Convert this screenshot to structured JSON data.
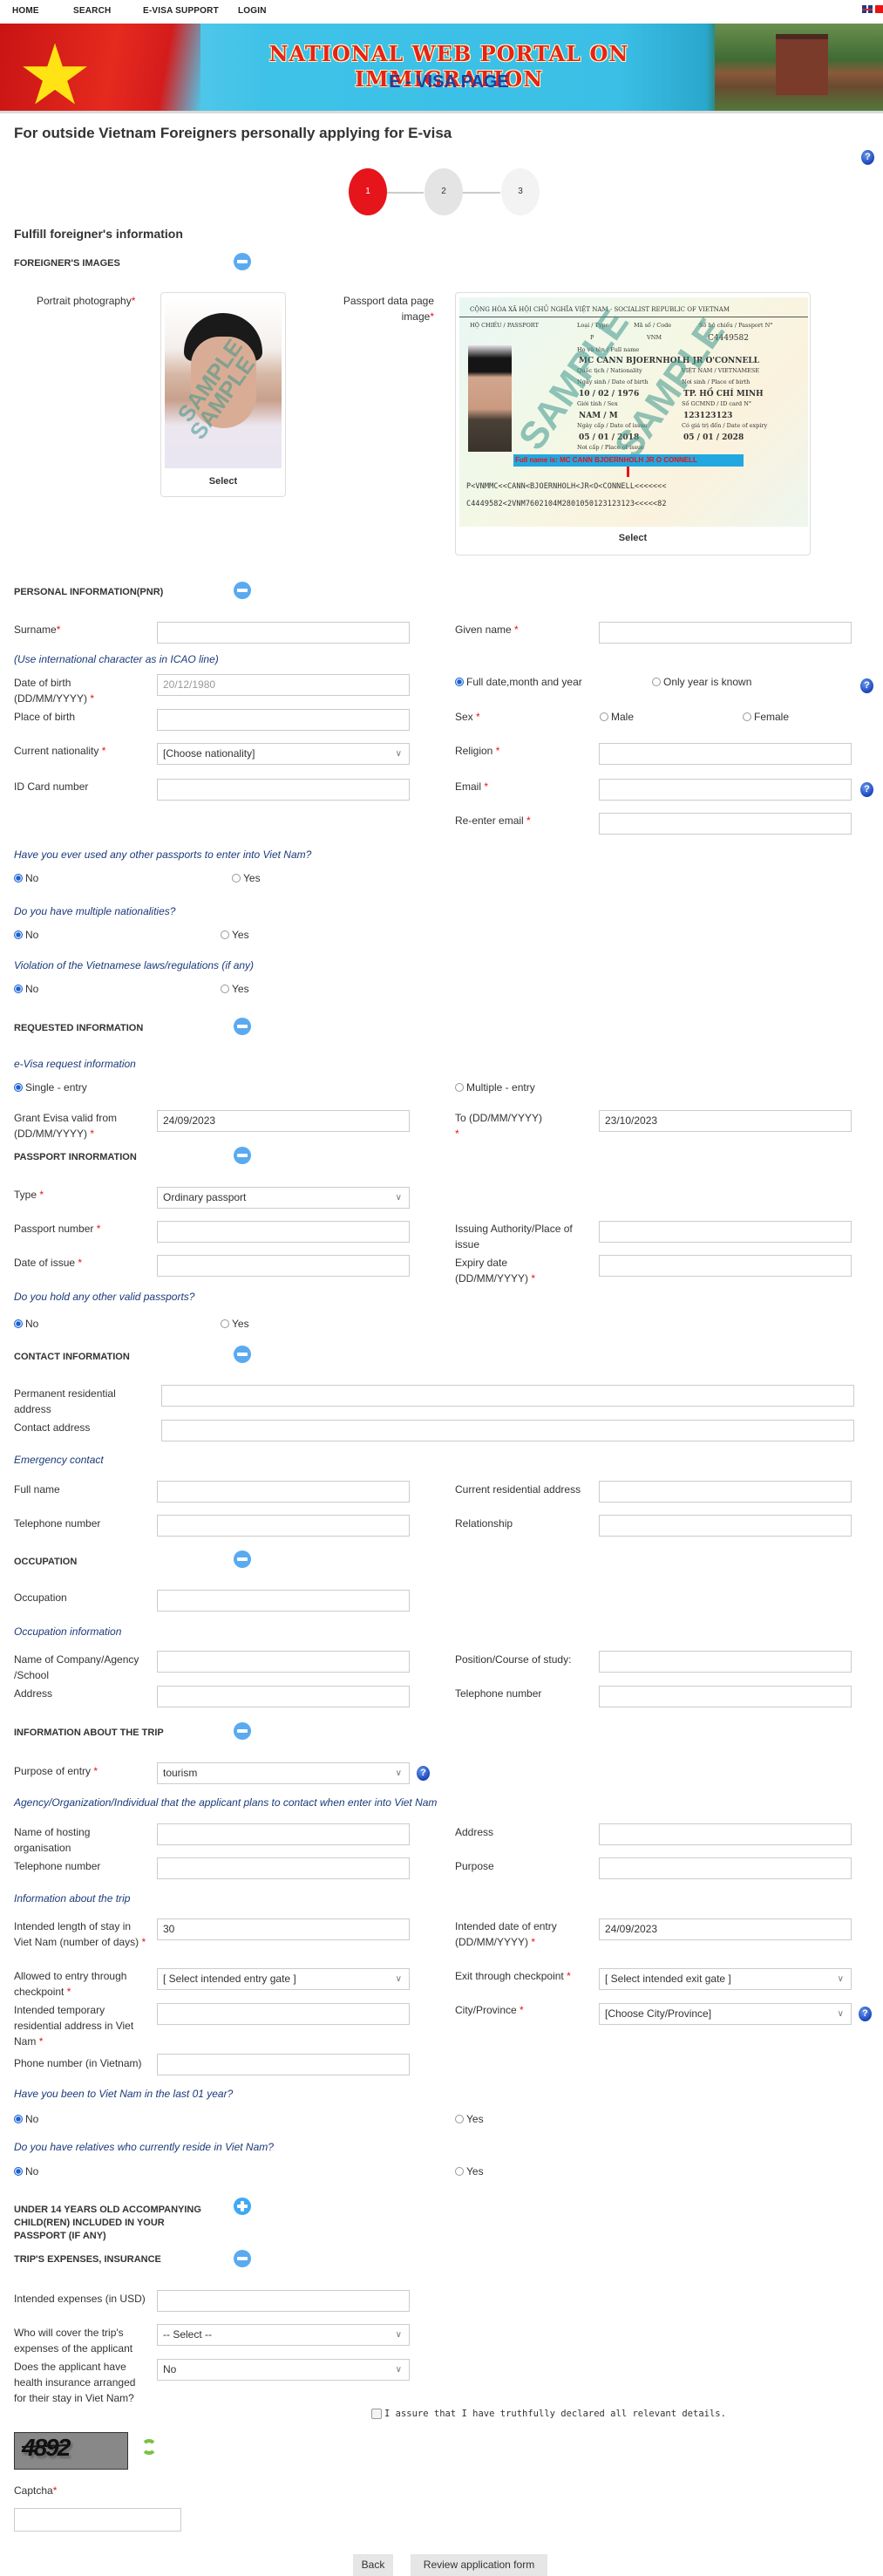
{
  "nav": {
    "items": [
      "HOME",
      "SEARCH",
      "E-VISA SUPPORT",
      "LOGIN"
    ],
    "languages": [
      "English",
      "Tiếng Việt"
    ]
  },
  "banner": {
    "title": "NATIONAL WEB PORTAL ON IMMIGRATION",
    "subtitle": "E - VISA PAGE"
  },
  "page_title": "For outside Vietnam Foreigners personally applying for E-visa",
  "stepper": {
    "steps": [
      "1",
      "2",
      "3"
    ],
    "current_step": 1,
    "colors": {
      "active": "#e6151b",
      "next": "#e4e4e4",
      "future": "#f3f3f3"
    }
  },
  "form_heading": "Fulfill foreigner's information",
  "images": {
    "section": "FOREIGNER'S IMAGES",
    "portrait_label": "Portrait photography",
    "passport_label": "Passport data page image",
    "select_label": "Select",
    "watermark": "SAMPLE",
    "passport_sample": {
      "header": "CỘNG HÒA XÃ HỘI CHỦ NGHĨA VIỆT NAM - SOCIALIST REPUBLIC OF VIETNAM",
      "passport_label": "HỘ CHIẾU / PASSPORT",
      "type_label": "Loại / Type",
      "type": "P",
      "code_label": "Mã số / Code",
      "code": "VNM",
      "number_label": "Số hộ chiếu / Passport N°",
      "number": "C4449582",
      "fullname_label": "Họ và tên / Full name",
      "fullname": "MC CANN BJOERNHOLH JR O'CONNELL",
      "nationality_label": "Quốc tịch / Nationality",
      "nationality": "VIỆT NAM / VIETNAMESE",
      "dob_label": "Ngày sinh / Date of birth",
      "dob": "10 / 02 / 1976",
      "pob_label": "Nơi sinh / Place of birth",
      "pob": "TP. HỒ CHÍ MINH",
      "sex_label": "Giới tính / Sex",
      "sex": "NAM / M",
      "id_label": "Số GCMND / ID card N°",
      "id": "123123123",
      "issue_label": "Ngày cấp / Date of issue",
      "issue": "05 / 01 / 2018",
      "expiry_label": "Có giá trị đến / Date of expiry",
      "expiry": "05 / 01 / 2028",
      "poi_label": "Nơi cấp / Place of issue",
      "fullname_note": "Full name is: MC CANN BJOERNHOLH JR O CONNELL",
      "mrz1": "P<VNMMC<<CANN<BJOERNHOLH<JR<O<CONNELL<<<<<<<",
      "mrz2": "C4449582<2VNM7602104M2801050123123123<<<<<82"
    }
  },
  "personal": {
    "section": "PERSONAL INFORMATION(PNR)",
    "surname_label": "Surname",
    "surname": "",
    "given_label": "Given name",
    "given": "",
    "icao_note": "(Use international character as in ICAO line)",
    "dob_label": "Date of birth (DD/MM/YYYY)",
    "dob_placeholder": "20/12/1980",
    "dob_mode_full": "Full date,month and year",
    "dob_mode_year": "Only year is known",
    "dob_mode_selected": "full",
    "pob_label": "Place of birth",
    "pob": "",
    "sex_label": "Sex",
    "sex_options": [
      "Male",
      "Female"
    ],
    "sex_selected": null,
    "nationality_label": "Current nationality",
    "nationality": "[Choose nationality]",
    "religion_label": "Religion",
    "religion": "",
    "idcard_label": "ID Card number",
    "idcard": "",
    "email_label": "Email",
    "email": "",
    "reemail_label": "Re-enter email",
    "reemail": ""
  },
  "questions": [
    {
      "q": "Have you ever used any other passports to enter into Viet Nam?",
      "options": [
        "No",
        "Yes"
      ],
      "selected": "No"
    },
    {
      "q": "Do you have multiple nationalities?",
      "options": [
        "No",
        "Yes"
      ],
      "selected": "No"
    },
    {
      "q": "Violation of the Vietnamese laws/regulations (if any)",
      "options": [
        "No",
        "Yes"
      ],
      "selected": "No"
    }
  ],
  "requested": {
    "section": "REQUESTED INFORMATION",
    "sub": "e-Visa request information",
    "entry_options": [
      "Single - entry",
      "Multiple - entry"
    ],
    "entry_selected": "Single - entry",
    "from_label": "Grant Evisa valid from (DD/MM/YYYY)",
    "from": "24/09/2023",
    "to_label": "To (DD/MM/YYYY)",
    "to": "23/10/2023"
  },
  "passport": {
    "section": "PASSPORT INRORMATION",
    "type_label": "Type",
    "type": "Ordinary passport",
    "number_label": "Passport number",
    "number": "",
    "authority_label": "Issuing Authority/Place of issue",
    "authority": "",
    "issue_label": "Date of issue",
    "issue": "",
    "expiry_label": "Expiry date (DD/MM/YYYY)",
    "expiry": "",
    "other_q": "Do you hold any other valid passports?",
    "other_options": [
      "No",
      "Yes"
    ],
    "other_selected": "No"
  },
  "contact": {
    "section": "CONTACT INFORMATION",
    "permanent_label": "Permanent residential address",
    "permanent": "",
    "contact_label": "Contact address",
    "contact": "",
    "emergency_sub": "Emergency contact",
    "fullname_label": "Full name",
    "fullname": "",
    "current_label": "Current residential address",
    "current": "",
    "phone_label": "Telephone number",
    "phone": "",
    "relationship_label": "Relationship",
    "relationship": ""
  },
  "occupation": {
    "section": "OCCUPATION",
    "occupation_label": "Occupation",
    "occupation": "",
    "sub": "Occupation information",
    "company_label": "Name of Company/Agency /School",
    "company": "",
    "position_label": "Position/Course of study:",
    "position": "",
    "address_label": "Address",
    "address": "",
    "phone_label": "Telephone number",
    "phone": ""
  },
  "trip": {
    "section": "INFORMATION ABOUT THE TRIP",
    "purpose_label": "Purpose of entry",
    "purpose": "tourism",
    "agency_sub": "Agency/Organization/Individual that the applicant plans to contact when enter into Viet Nam",
    "host_label": "Name of hosting organisation",
    "host": "",
    "host_address_label": "Address",
    "host_address": "",
    "host_phone_label": "Telephone number",
    "host_phone": "",
    "host_purpose_label": "Purpose",
    "host_purpose": "",
    "info_sub": "Information about the trip",
    "stay_label": "Intended length of stay in Viet Nam (number of days)",
    "stay": "30",
    "entry_date_label": "Intended date of entry (DD/MM/YYYY)",
    "entry_date": "24/09/2023",
    "entry_gate_label": "Allowed to entry through checkpoint",
    "entry_gate": "[ Select intended entry gate ]",
    "exit_gate_label": "Exit through checkpoint",
    "exit_gate": "[ Select intended exit gate ]",
    "temp_address_label": "Intended temporary residential address in Viet Nam",
    "temp_address": "",
    "city_label": "City/Province",
    "city": "[Choose City/Province]",
    "phone_label": "Phone number (in Vietnam)",
    "phone": "",
    "been_q": "Have you been to Viet Nam in the last 01 year?",
    "been_options": [
      "No",
      "Yes"
    ],
    "been_selected": "No",
    "relatives_q": "Do you have relatives who currently reside in Viet Nam?",
    "relatives_options": [
      "No",
      "Yes"
    ],
    "relatives_selected": "No"
  },
  "children": {
    "section": "UNDER 14 YEARS OLD ACCOMPANYING CHILD(REN) INCLUDED IN YOUR PASSPORT (IF ANY)"
  },
  "expenses": {
    "section": "TRIP'S EXPENSES, INSURANCE",
    "amount_label": "Intended expenses (in USD)",
    "amount": "",
    "cover_label": "Who will cover the trip's expenses of the applicant",
    "cover": "-- Select --",
    "insurance_label": "Does the applicant have health insurance arranged for their stay in Viet Nam?",
    "insurance": "No"
  },
  "declaration": {
    "text": "I assure that I have truthfully declared all relevant details.",
    "checked": false
  },
  "captcha": {
    "image_text": "4892",
    "label": "Captcha",
    "value": ""
  },
  "buttons": {
    "back": "Back",
    "review": "Review application form"
  }
}
